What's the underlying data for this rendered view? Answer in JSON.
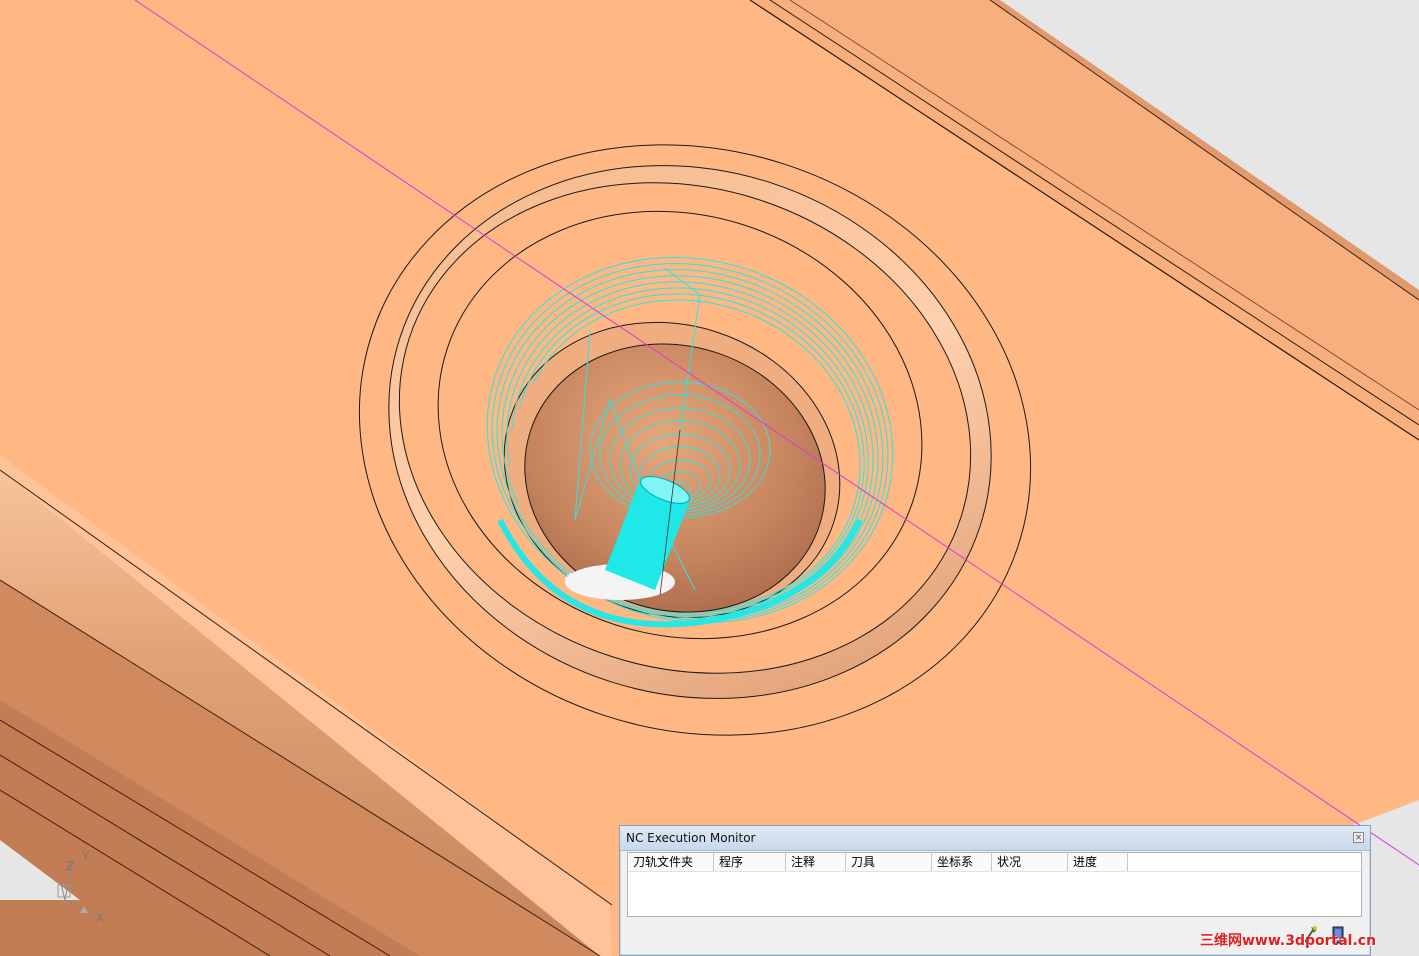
{
  "viewport": {
    "axis_triad": {
      "x_label": "X",
      "y_label": "Y",
      "z_label": "Z"
    }
  },
  "monitor": {
    "title": "NC Execution Monitor",
    "columns": [
      "刀轨文件夹",
      "程序",
      "注释",
      "刀具",
      "坐标系",
      "状况",
      "进度"
    ]
  },
  "watermark": {
    "text": "三维网www.3dportal.cn"
  },
  "colors": {
    "part_surface": "#ffb784",
    "part_shade": "#c8825a",
    "toolpath": "#27e6e6",
    "axis_line": "#d63bd6",
    "edge": "#1a1a1a"
  }
}
